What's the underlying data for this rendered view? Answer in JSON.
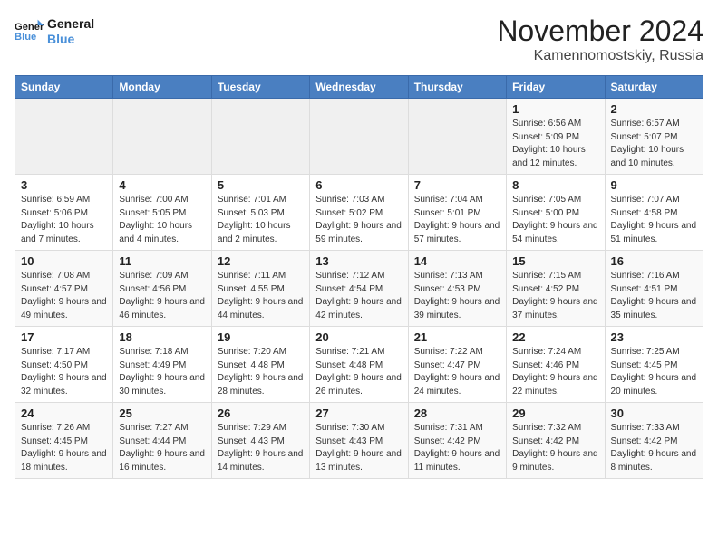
{
  "header": {
    "logo_general": "General",
    "logo_blue": "Blue",
    "month_title": "November 2024",
    "location": "Kamennomostskiy, Russia"
  },
  "weekdays": [
    "Sunday",
    "Monday",
    "Tuesday",
    "Wednesday",
    "Thursday",
    "Friday",
    "Saturday"
  ],
  "weeks": [
    [
      {
        "day": "",
        "info": ""
      },
      {
        "day": "",
        "info": ""
      },
      {
        "day": "",
        "info": ""
      },
      {
        "day": "",
        "info": ""
      },
      {
        "day": "",
        "info": ""
      },
      {
        "day": "1",
        "info": "Sunrise: 6:56 AM\nSunset: 5:09 PM\nDaylight: 10 hours and 12 minutes."
      },
      {
        "day": "2",
        "info": "Sunrise: 6:57 AM\nSunset: 5:07 PM\nDaylight: 10 hours and 10 minutes."
      }
    ],
    [
      {
        "day": "3",
        "info": "Sunrise: 6:59 AM\nSunset: 5:06 PM\nDaylight: 10 hours and 7 minutes."
      },
      {
        "day": "4",
        "info": "Sunrise: 7:00 AM\nSunset: 5:05 PM\nDaylight: 10 hours and 4 minutes."
      },
      {
        "day": "5",
        "info": "Sunrise: 7:01 AM\nSunset: 5:03 PM\nDaylight: 10 hours and 2 minutes."
      },
      {
        "day": "6",
        "info": "Sunrise: 7:03 AM\nSunset: 5:02 PM\nDaylight: 9 hours and 59 minutes."
      },
      {
        "day": "7",
        "info": "Sunrise: 7:04 AM\nSunset: 5:01 PM\nDaylight: 9 hours and 57 minutes."
      },
      {
        "day": "8",
        "info": "Sunrise: 7:05 AM\nSunset: 5:00 PM\nDaylight: 9 hours and 54 minutes."
      },
      {
        "day": "9",
        "info": "Sunrise: 7:07 AM\nSunset: 4:58 PM\nDaylight: 9 hours and 51 minutes."
      }
    ],
    [
      {
        "day": "10",
        "info": "Sunrise: 7:08 AM\nSunset: 4:57 PM\nDaylight: 9 hours and 49 minutes."
      },
      {
        "day": "11",
        "info": "Sunrise: 7:09 AM\nSunset: 4:56 PM\nDaylight: 9 hours and 46 minutes."
      },
      {
        "day": "12",
        "info": "Sunrise: 7:11 AM\nSunset: 4:55 PM\nDaylight: 9 hours and 44 minutes."
      },
      {
        "day": "13",
        "info": "Sunrise: 7:12 AM\nSunset: 4:54 PM\nDaylight: 9 hours and 42 minutes."
      },
      {
        "day": "14",
        "info": "Sunrise: 7:13 AM\nSunset: 4:53 PM\nDaylight: 9 hours and 39 minutes."
      },
      {
        "day": "15",
        "info": "Sunrise: 7:15 AM\nSunset: 4:52 PM\nDaylight: 9 hours and 37 minutes."
      },
      {
        "day": "16",
        "info": "Sunrise: 7:16 AM\nSunset: 4:51 PM\nDaylight: 9 hours and 35 minutes."
      }
    ],
    [
      {
        "day": "17",
        "info": "Sunrise: 7:17 AM\nSunset: 4:50 PM\nDaylight: 9 hours and 32 minutes."
      },
      {
        "day": "18",
        "info": "Sunrise: 7:18 AM\nSunset: 4:49 PM\nDaylight: 9 hours and 30 minutes."
      },
      {
        "day": "19",
        "info": "Sunrise: 7:20 AM\nSunset: 4:48 PM\nDaylight: 9 hours and 28 minutes."
      },
      {
        "day": "20",
        "info": "Sunrise: 7:21 AM\nSunset: 4:48 PM\nDaylight: 9 hours and 26 minutes."
      },
      {
        "day": "21",
        "info": "Sunrise: 7:22 AM\nSunset: 4:47 PM\nDaylight: 9 hours and 24 minutes."
      },
      {
        "day": "22",
        "info": "Sunrise: 7:24 AM\nSunset: 4:46 PM\nDaylight: 9 hours and 22 minutes."
      },
      {
        "day": "23",
        "info": "Sunrise: 7:25 AM\nSunset: 4:45 PM\nDaylight: 9 hours and 20 minutes."
      }
    ],
    [
      {
        "day": "24",
        "info": "Sunrise: 7:26 AM\nSunset: 4:45 PM\nDaylight: 9 hours and 18 minutes."
      },
      {
        "day": "25",
        "info": "Sunrise: 7:27 AM\nSunset: 4:44 PM\nDaylight: 9 hours and 16 minutes."
      },
      {
        "day": "26",
        "info": "Sunrise: 7:29 AM\nSunset: 4:43 PM\nDaylight: 9 hours and 14 minutes."
      },
      {
        "day": "27",
        "info": "Sunrise: 7:30 AM\nSunset: 4:43 PM\nDaylight: 9 hours and 13 minutes."
      },
      {
        "day": "28",
        "info": "Sunrise: 7:31 AM\nSunset: 4:42 PM\nDaylight: 9 hours and 11 minutes."
      },
      {
        "day": "29",
        "info": "Sunrise: 7:32 AM\nSunset: 4:42 PM\nDaylight: 9 hours and 9 minutes."
      },
      {
        "day": "30",
        "info": "Sunrise: 7:33 AM\nSunset: 4:42 PM\nDaylight: 9 hours and 8 minutes."
      }
    ]
  ]
}
